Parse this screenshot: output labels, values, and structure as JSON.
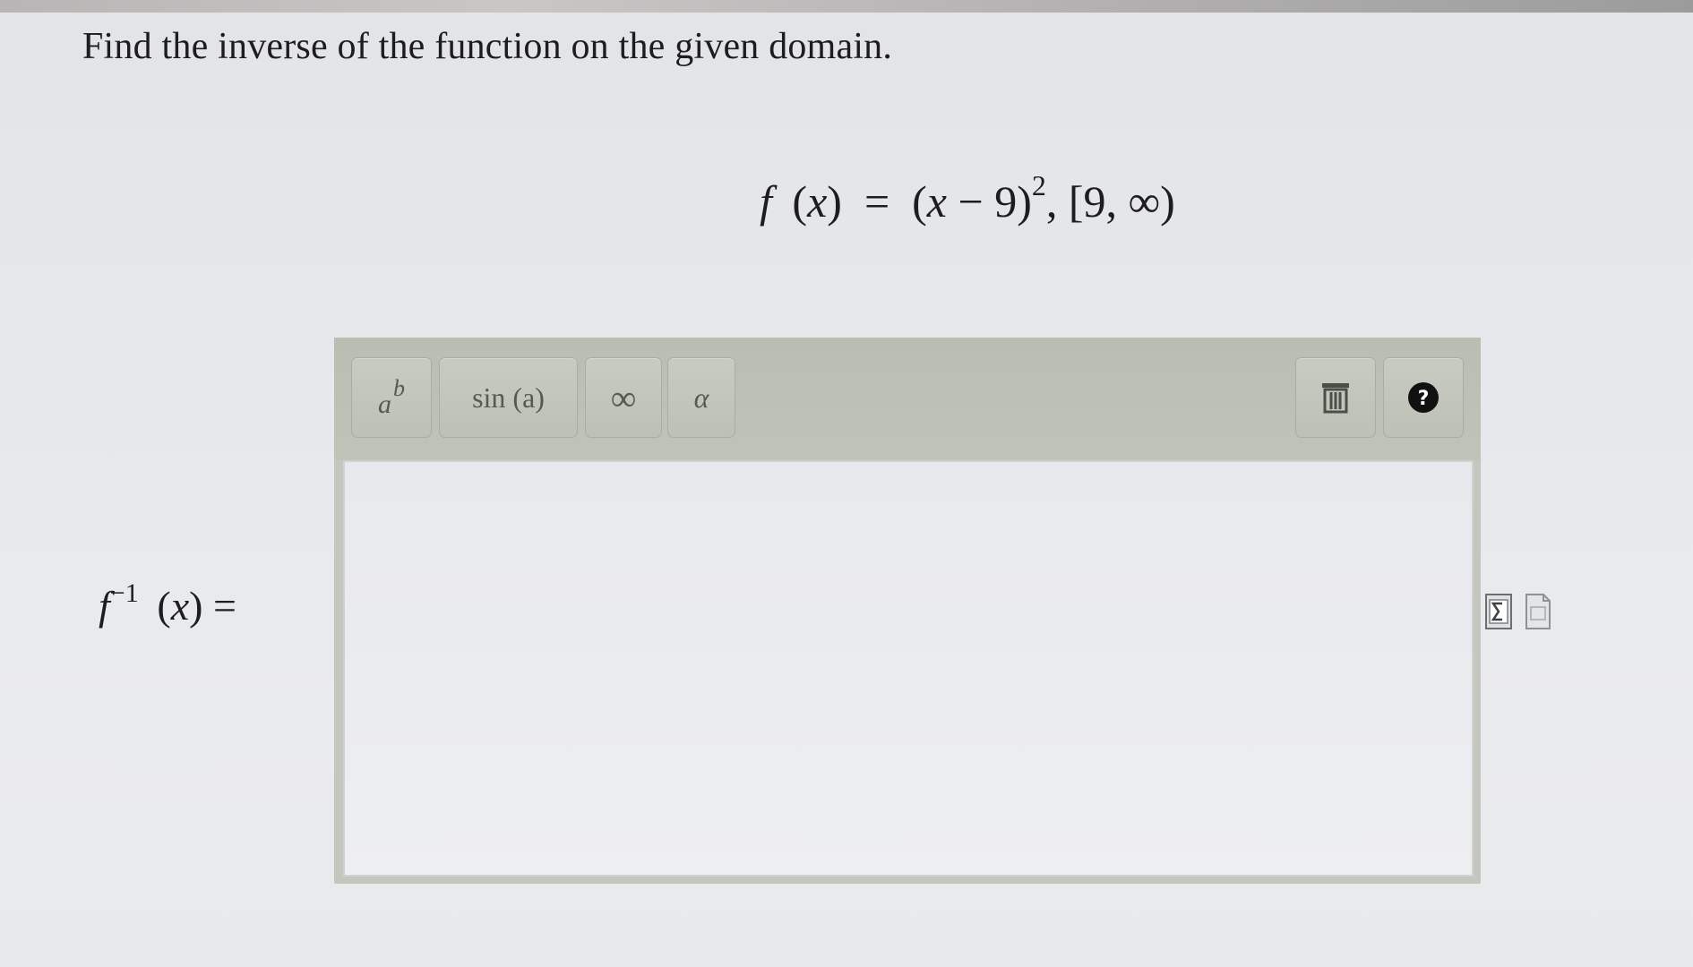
{
  "question": {
    "instruction": "Find the inverse of the function on the given domain.",
    "function": {
      "name": "f",
      "variable": "x",
      "body_open": "(",
      "variable_in_body": "x",
      "operator_constant": " − 9)",
      "exponent": "2",
      "domain": ", [9, ∞)"
    }
  },
  "answer": {
    "label_name": "f",
    "label_exponent": "−1",
    "label_variable": "x",
    "value": ""
  },
  "toolbar": {
    "power_base": "a",
    "power_exponent": "b",
    "trig_label": "sin (a)",
    "infinity_label": "∞",
    "greek_label": "α",
    "trash_icon": "trash-icon",
    "help_icon": "help-icon"
  },
  "side_tools": [
    "math-symbols-icon",
    "document-icon"
  ],
  "colors": {
    "toolbar": "#bfc3b8",
    "answer_bg": "#ebecef",
    "text": "#1d1d1d"
  }
}
